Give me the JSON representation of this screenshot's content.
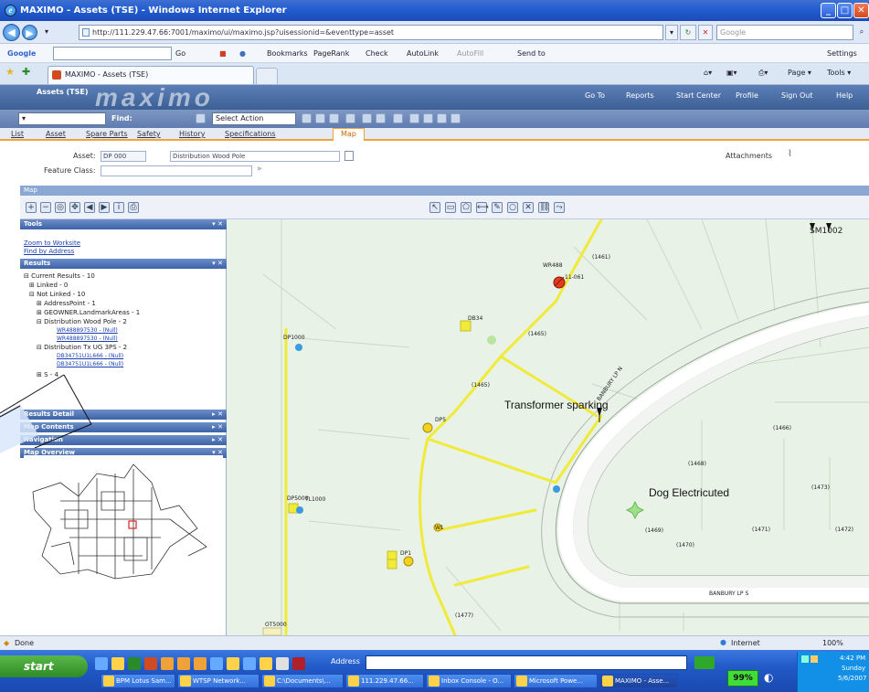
{
  "window": {
    "title": "MAXIMO - Assets (TSE) - Windows Internet Explorer"
  },
  "address_bar": {
    "url": "http://111.229.47.66:7001/maximo/ui/maximo.jsp?uisessionid=&eventtype=asset",
    "search_placeholder": "Google"
  },
  "google_toolbar": {
    "brand": "Google",
    "items": [
      "Go",
      "Bookmarks",
      "PageRank",
      "Check",
      "AutoLink",
      "AutoFill",
      "Send to"
    ],
    "settings": "Settings"
  },
  "browser_tabs": {
    "active_tab": "MAXIMO - Assets (TSE)",
    "page_menu": "Page",
    "tools_menu": "Tools"
  },
  "maximo": {
    "app_title": "Assets (TSE)",
    "logo": "maximo",
    "nav": [
      "Go To",
      "Reports",
      "Start Center",
      "Profile",
      "Sign Out",
      "Help"
    ],
    "find_label": "Find:",
    "select_action": "Select Action",
    "tabs": [
      "List",
      "Asset",
      "Spare Parts",
      "Safety",
      "History",
      "Specifications",
      "Map"
    ],
    "active_tab": "Map",
    "asset_label": "Asset:",
    "asset_value": "DP 000",
    "asset_description": "Distribution Wood Pole",
    "feature_class_label": "Feature Class:",
    "attachments_label": "Attachments"
  },
  "map_section": {
    "title": "Map",
    "panels": {
      "tools": "Tools",
      "tools_links": [
        "Zoom to Worksite",
        "Find by Address"
      ],
      "results": "Results",
      "results_tree": [
        "Current Results - 10",
        "Linked - 0",
        "Not Linked - 10",
        "AddressPoint - 1",
        "GEOWNER.LandmarkAreas - 1",
        "Distribution Wood Pole - 2",
        "Distribution Tx UG 3PS - 2",
        "S - 4"
      ],
      "results_links": [
        "WR488897530 - (Null)",
        "WR488897530 - (Null)",
        "DB34751U1L666 - (Null)",
        "DB34751U1L666 - (Null)"
      ],
      "collapsed": [
        "Results Detail",
        "Map Contents",
        "Navigation",
        "Map Overview"
      ]
    },
    "map_labels": {
      "big": [
        "Transformer sparking",
        "Dog Electricuted"
      ],
      "streets": [
        "BANBURY LP N",
        "BANBURY LP S"
      ],
      "corner": "SM1002",
      "small": [
        "(1461)",
        "(1465)",
        "(1465)",
        "(1466)",
        "(1468)",
        "(1469)",
        "(1470)",
        "(1471)",
        "(1472)",
        "(1473)",
        "WR488",
        "DB34",
        "DP5",
        "DP1",
        "DP1000",
        "DP5000",
        "TL1000",
        "11-061",
        "W1",
        "(1477)",
        "OT5000"
      ]
    }
  },
  "status": {
    "left": "Done",
    "zone": "Internet",
    "zoom": "100%"
  },
  "taskbar": {
    "start": "start",
    "address_label": "Address",
    "battery": "99%",
    "clock": "4:42 PM",
    "day": "Sunday",
    "date": "5/6/2007",
    "items": [
      "BPM Lotus Sam...",
      "WTSP Network...",
      "C:\\Documents\\...",
      "111.229.47.66...",
      "Inbox Console - O...",
      "Microsoft Powe...",
      "MAXIMO - Asse..."
    ]
  },
  "colors": {
    "accent": "#f0a239",
    "banner": "#4a6ea6",
    "line_yellow": "#f2ec3a",
    "map_bg": "#e9f2e6"
  }
}
